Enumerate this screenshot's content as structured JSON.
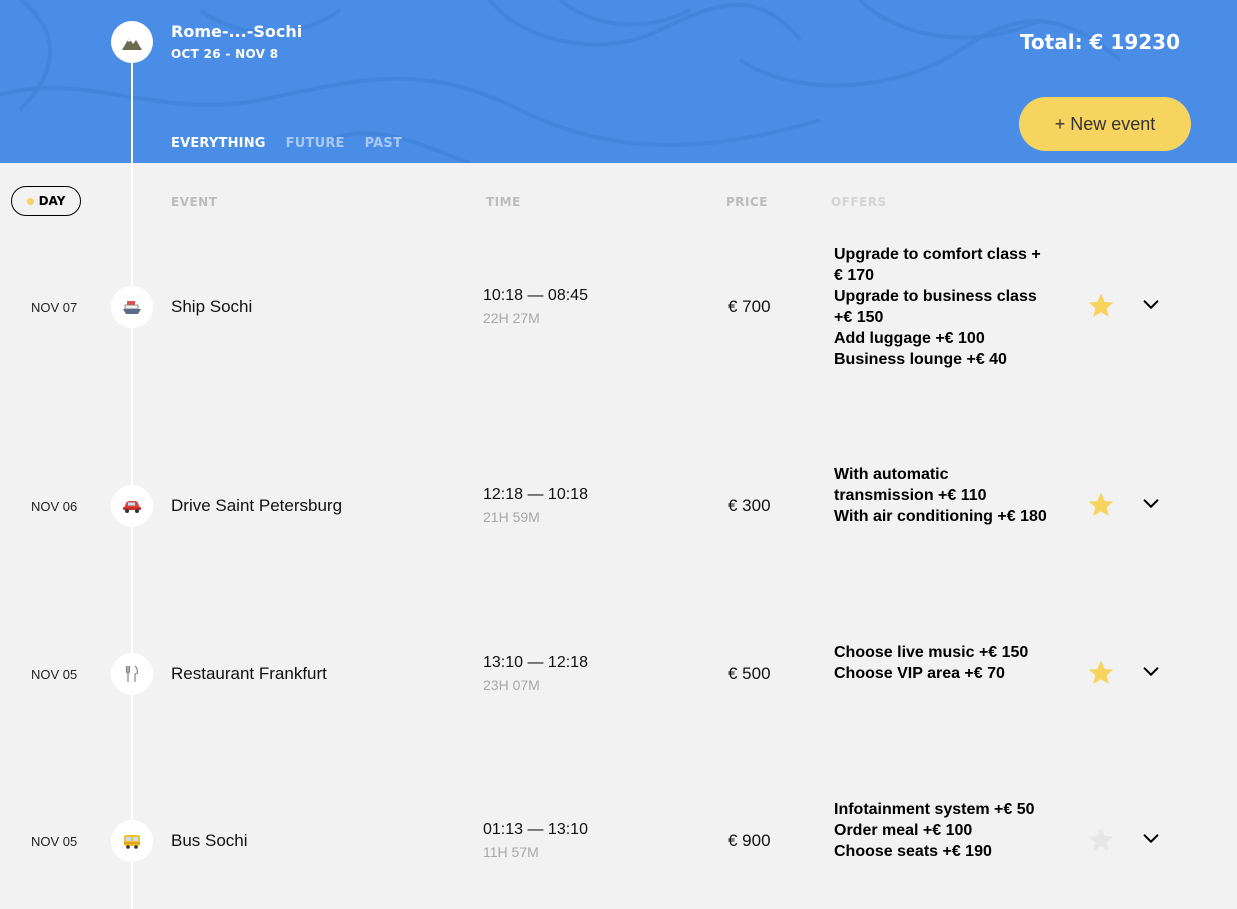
{
  "header": {
    "trip_title": "Rome-...-Sochi",
    "trip_dates": "OCT 26 - NOV 8",
    "total_label": "Total: € 19230",
    "new_event_label": "+ New event",
    "filters": [
      {
        "label": "EVERYTHING",
        "active": true
      },
      {
        "label": "FUTURE",
        "active": false
      },
      {
        "label": "PAST",
        "active": false
      }
    ]
  },
  "sort": {
    "day_label": "DAY",
    "columns": [
      "EVENT",
      "TIME",
      "PRICE",
      "OFFERS"
    ]
  },
  "events": [
    {
      "date": "NOV 07",
      "icon": "ship-icon",
      "name": "Ship Sochi",
      "time": "10:18 — 08:45",
      "duration": "22H 27M",
      "price": "€ 700",
      "offers": [
        "Upgrade to comfort class +€  170",
        "Upgrade to business class +€  150",
        "Add luggage +€  100",
        "Business lounge +€  40"
      ],
      "favorite": true
    },
    {
      "date": "NOV 06",
      "icon": "car-icon",
      "name": "Drive Saint Petersburg",
      "time": "12:18 — 10:18",
      "duration": "21H 59M",
      "price": "€ 300",
      "offers": [
        "With automatic transmission +€  110",
        "With air conditioning +€  180"
      ],
      "favorite": true
    },
    {
      "date": "NOV 05",
      "icon": "restaurant-icon",
      "name": "Restaurant Frankfurt",
      "time": "13:10 — 12:18",
      "duration": "23H 07M",
      "price": "€ 500",
      "offers": [
        "Choose live music +€  150",
        "Choose VIP area +€  70"
      ],
      "favorite": true
    },
    {
      "date": "NOV 05",
      "icon": "bus-icon",
      "name": "Bus Sochi",
      "time": "01:13 — 13:10",
      "duration": "11H 57M",
      "price": "€ 900",
      "offers": [
        "Infotainment system +€  50",
        "Order meal +€  100",
        "Choose seats +€  190"
      ],
      "favorite": false
    }
  ],
  "colors": {
    "header_bg": "#4a8de6",
    "accent_yellow": "#f7d35f",
    "star_active": "#f7d35f",
    "star_inactive": "#e6e6e6"
  }
}
